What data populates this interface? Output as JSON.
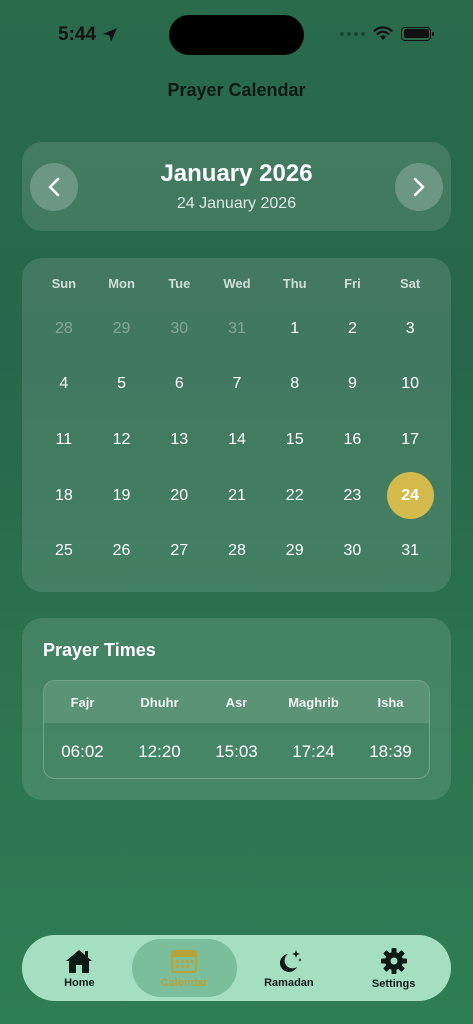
{
  "status_bar": {
    "time": "5:44"
  },
  "nav": {
    "title": "Prayer Calendar"
  },
  "month": {
    "title": "January 2026",
    "subtitle": "24 January 2026"
  },
  "calendar": {
    "weekdays": [
      "Sun",
      "Mon",
      "Tue",
      "Wed",
      "Thu",
      "Fri",
      "Sat"
    ],
    "days": [
      {
        "label": "28",
        "muted": true
      },
      {
        "label": "29",
        "muted": true
      },
      {
        "label": "30",
        "muted": true
      },
      {
        "label": "31",
        "muted": true
      },
      {
        "label": "1"
      },
      {
        "label": "2"
      },
      {
        "label": "3"
      },
      {
        "label": "4"
      },
      {
        "label": "5"
      },
      {
        "label": "6"
      },
      {
        "label": "7"
      },
      {
        "label": "8"
      },
      {
        "label": "9"
      },
      {
        "label": "10"
      },
      {
        "label": "11"
      },
      {
        "label": "12"
      },
      {
        "label": "13"
      },
      {
        "label": "14"
      },
      {
        "label": "15"
      },
      {
        "label": "16"
      },
      {
        "label": "17"
      },
      {
        "label": "18"
      },
      {
        "label": "19"
      },
      {
        "label": "20"
      },
      {
        "label": "21"
      },
      {
        "label": "22"
      },
      {
        "label": "23"
      },
      {
        "label": "24",
        "selected": true
      },
      {
        "label": "25"
      },
      {
        "label": "26"
      },
      {
        "label": "27"
      },
      {
        "label": "28"
      },
      {
        "label": "29"
      },
      {
        "label": "30"
      },
      {
        "label": "31"
      }
    ],
    "selected_color": "#d4b94c"
  },
  "prayer_times": {
    "title": "Prayer Times",
    "names": [
      "Fajr",
      "Dhuhr",
      "Asr",
      "Maghrib",
      "Isha"
    ],
    "times": [
      "06:02",
      "12:20",
      "15:03",
      "17:24",
      "18:39"
    ]
  },
  "tabbar": {
    "tabs": [
      {
        "label": "Home",
        "icon": "home-icon"
      },
      {
        "label": "Calendar",
        "icon": "calendar-icon",
        "active": true
      },
      {
        "label": "Ramadan",
        "icon": "moon-stars-icon"
      },
      {
        "label": "Settings",
        "icon": "gear-icon"
      }
    ],
    "active_color": "#b8a23a"
  }
}
